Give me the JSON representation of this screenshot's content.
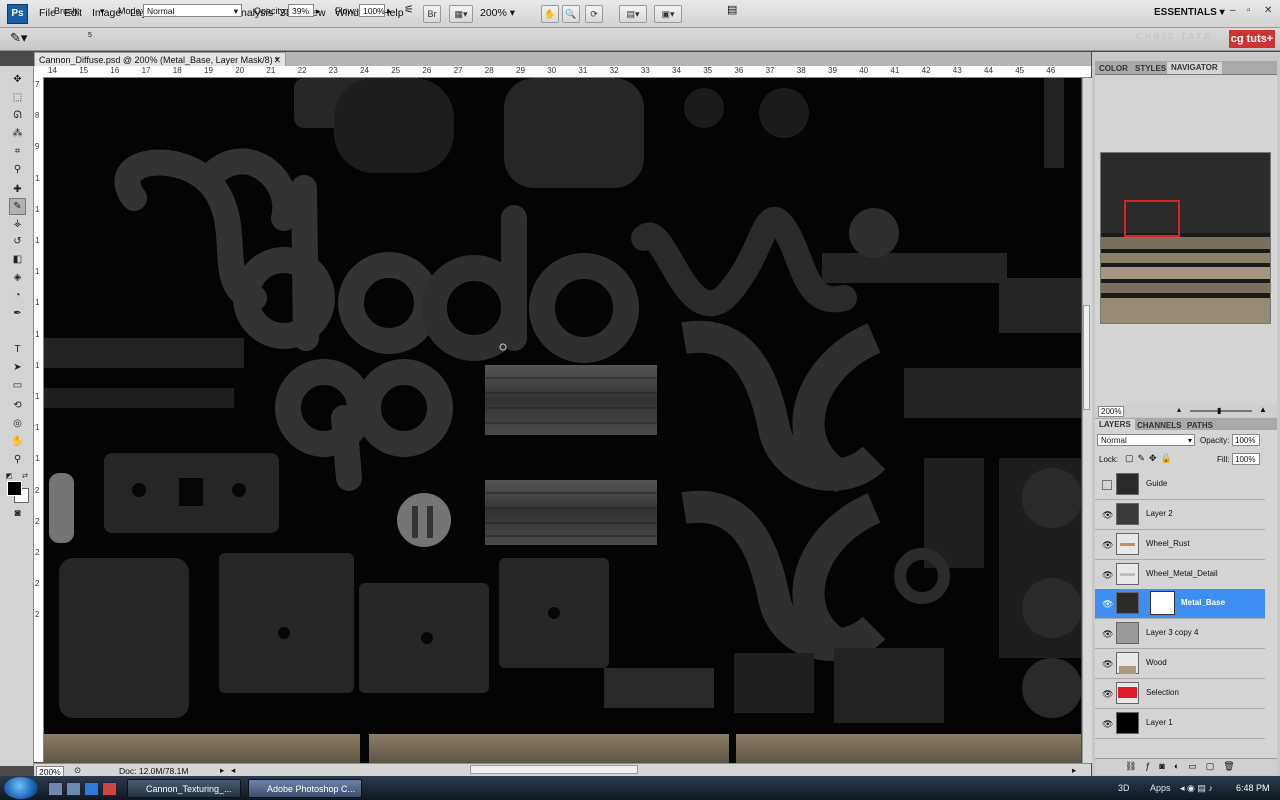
{
  "app": {
    "logo": "Ps"
  },
  "menu": {
    "items": [
      "File",
      "Edit",
      "Image",
      "Layer",
      "Select",
      "Filter",
      "Analysis",
      "3D",
      "View",
      "Window",
      "Help"
    ],
    "zoom": "200%",
    "workspace": "ESSENTIALS",
    "bridge": "Br"
  },
  "options": {
    "brush_label": "Brush:",
    "brush_size": "5",
    "mode_label": "Mode:",
    "mode_value": "Normal",
    "opacity_label": "Opacity:",
    "opacity_value": "39%",
    "flow_label": "Flow:",
    "flow_value": "100%",
    "brand_text": "CHRIS TATE",
    "brand_logo": "cg tuts+"
  },
  "document": {
    "tab_title": "Cannon_Diffuse.psd @ 200% (Metal_Base, Layer Mask/8) *"
  },
  "ruler": {
    "h_labels": [
      "14",
      "15",
      "16",
      "17",
      "18",
      "19",
      "20",
      "21",
      "22",
      "23",
      "24",
      "25",
      "26",
      "27",
      "28",
      "29",
      "30",
      "31",
      "32",
      "33",
      "34",
      "35",
      "36",
      "37",
      "38",
      "39",
      "40",
      "41",
      "42",
      "43",
      "44",
      "45",
      "46"
    ],
    "v_labels": [
      "7",
      "8",
      "9",
      "1",
      "1",
      "1",
      "1",
      "1",
      "1",
      "1",
      "1",
      "1",
      "1",
      "2",
      "2",
      "2",
      "2",
      "2"
    ]
  },
  "status": {
    "zoom": "200%",
    "doc": "Doc: 12.0M/78.1M"
  },
  "panels": {
    "top_tabs": [
      "COLOR",
      "STYLES",
      "NAVIGATOR"
    ],
    "navigator_zoom": "200%",
    "layer_tabs": [
      "LAYERS",
      "CHANNELS",
      "PATHS"
    ],
    "blend_mode": "Normal",
    "opacity_label": "Opacity:",
    "opacity_value": "100%",
    "lock_label": "Lock:",
    "fill_label": "Fill:",
    "fill_value": "100%"
  },
  "layers": [
    {
      "name": "Guide",
      "visible": false,
      "thumb": "#2a2a2a"
    },
    {
      "name": "Layer 2",
      "visible": true,
      "thumb": "#3a3a3a"
    },
    {
      "name": "Wheel_Rust",
      "visible": true,
      "thumb": "#c98a5e"
    },
    {
      "name": "Wheel_Metal_Detail",
      "visible": true,
      "thumb": "#bdbdbd"
    },
    {
      "name": "Metal_Base",
      "visible": true,
      "thumb": "#2b2b2b",
      "selected": true
    },
    {
      "name": "Layer 3 copy 4",
      "visible": true,
      "thumb": "#9a9a9a"
    },
    {
      "name": "Wood",
      "visible": true,
      "thumb": "#a89a80"
    },
    {
      "name": "Selection",
      "visible": true,
      "thumb": "#e11d2a"
    },
    {
      "name": "Layer 1",
      "visible": true,
      "thumb": "#000000"
    }
  ],
  "taskbar": {
    "buttons": [
      "Cannon_Texturing_...",
      "Adobe Photoshop C..."
    ],
    "tray": [
      "3D",
      "Apps"
    ],
    "clock": "6:48 PM"
  }
}
